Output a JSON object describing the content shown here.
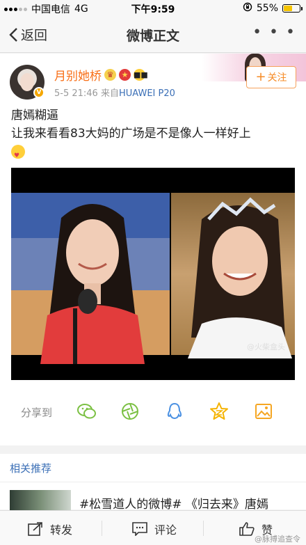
{
  "status_bar": {
    "carrier": "中国电信",
    "network": "4G",
    "time": "下午9:59",
    "battery": "55%",
    "battery_level": 0.55
  },
  "nav": {
    "back_label": "返回",
    "title": "微博正文"
  },
  "post": {
    "username": "月别她桥",
    "meta_time": "5-5 21:46",
    "meta_source_prefix": "来自",
    "meta_device": "HUAWEI P20",
    "follow_label": "关注",
    "text_line1": "唐嫣糊逼",
    "text_line2": "让我来看看83大妈的广场是不是像人一样好上",
    "image_watermark": "@火柴盒头"
  },
  "share": {
    "label": "分享到",
    "icons": [
      "wechat-icon",
      "moments-icon",
      "qq-icon",
      "qzone-icon",
      "save-image-icon"
    ]
  },
  "recommend": {
    "title": "相关推荐",
    "item_text": "#松雪道人的微博# 《归去来》唐嫣"
  },
  "toolbar": {
    "repost_label": "转发",
    "comment_label": "评论",
    "like_label": "赞",
    "watermark": "@脉搏追查令"
  },
  "colors": {
    "accent_orange": "#f68b26",
    "link_blue": "#3b6fb6",
    "icon_green": "#7bc043",
    "icon_blue": "#4a90e2",
    "icon_yellow": "#f5b301"
  }
}
